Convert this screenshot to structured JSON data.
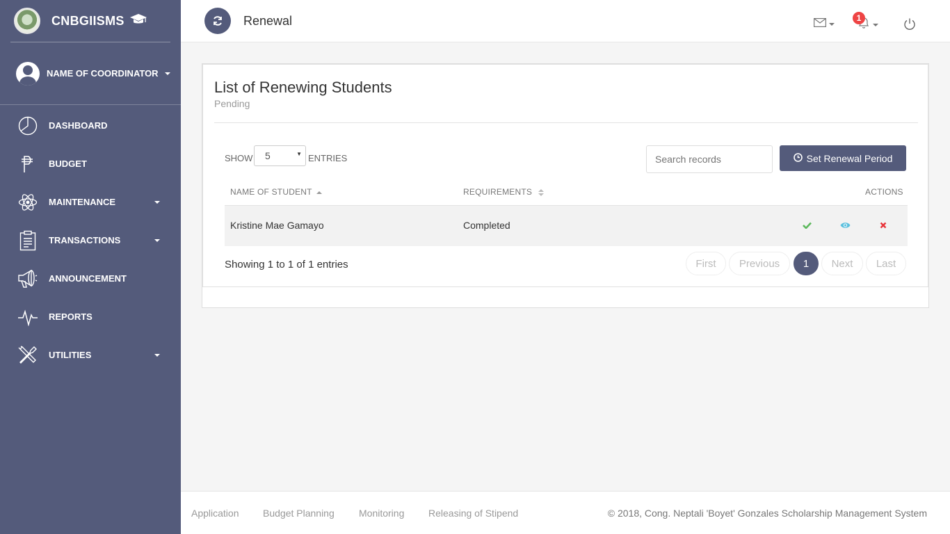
{
  "brand": {
    "name": "CNBGIISMS"
  },
  "user": {
    "name": "NAME OF COORDINATOR"
  },
  "sidebar": {
    "items": [
      {
        "label": "DASHBOARD",
        "icon": "pie-chart-icon",
        "has_dropdown": false
      },
      {
        "label": "BUDGET",
        "icon": "peso-icon",
        "has_dropdown": false
      },
      {
        "label": "MAINTENANCE",
        "icon": "atom-icon",
        "has_dropdown": true
      },
      {
        "label": "TRANSACTIONS",
        "icon": "clipboard-icon",
        "has_dropdown": true
      },
      {
        "label": "ANNOUNCEMENT",
        "icon": "megaphone-icon",
        "has_dropdown": false
      },
      {
        "label": "REPORTS",
        "icon": "pulse-icon",
        "has_dropdown": false
      },
      {
        "label": "UTILITIES",
        "icon": "tools-icon",
        "has_dropdown": true
      }
    ]
  },
  "header": {
    "title": "Renewal",
    "notification_count": "1"
  },
  "card": {
    "title": "List of Renewing Students",
    "subtitle": "Pending"
  },
  "table_controls": {
    "show_label": "SHOW",
    "entries_value": "5",
    "entries_label": "ENTRIES",
    "search_placeholder": "Search records",
    "set_period_label": "Set Renewal Period"
  },
  "table": {
    "columns": [
      "NAME OF STUDENT",
      "REQUIREMENTS",
      "ACTIONS"
    ],
    "rows": [
      {
        "name": "Kristine Mae Gamayo",
        "requirements": "Completed"
      }
    ]
  },
  "pagination": {
    "info": "Showing 1 to 1 of 1 entries",
    "first": "First",
    "previous": "Previous",
    "current": "1",
    "next": "Next",
    "last": "Last"
  },
  "footer": {
    "links": [
      "Application",
      "Budget Planning",
      "Monitoring",
      "Releasing of Stipend"
    ],
    "copyright": "© 2018, Cong. Neptali 'Boyet' Gonzales Scholarship Management System"
  },
  "colors": {
    "sidebar": "#545b7b",
    "accent": "#545b7b",
    "approve": "#5cb85c",
    "view": "#5bc0de",
    "reject": "#e8343a",
    "badge": "#ee4444"
  }
}
